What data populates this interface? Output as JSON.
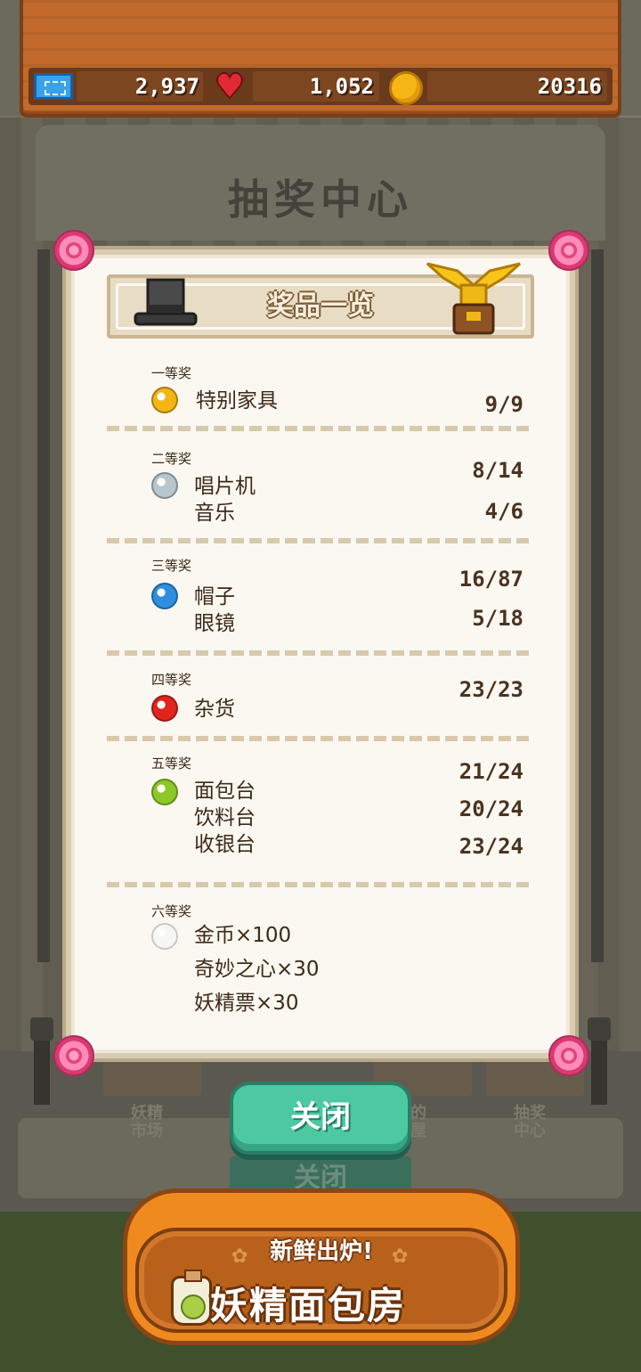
{
  "hud": {
    "tickets": "2,937",
    "hearts": "1,052",
    "coins": "20316"
  },
  "background": {
    "title": "抽奖中心",
    "labels": [
      "妖精\n市场",
      "的\n屋",
      "抽奖\n中心"
    ],
    "close_ghost": "关闭"
  },
  "modal": {
    "title": "奖品一览",
    "tiers": [
      {
        "label": "一等奖",
        "gem_color": "#f2b514",
        "items": [
          {
            "name": "特别家具",
            "count": "9/9"
          }
        ]
      },
      {
        "label": "二等奖",
        "gem_color": "#b7c7cd",
        "items": [
          {
            "name": "唱片机",
            "count": "8/14"
          },
          {
            "name": "音乐",
            "count": "4/6"
          }
        ]
      },
      {
        "label": "三等奖",
        "gem_color": "#2e8fe0",
        "items": [
          {
            "name": "帽子",
            "count": "16/87"
          },
          {
            "name": "眼镜",
            "count": "5/18"
          }
        ]
      },
      {
        "label": "四等奖",
        "gem_color": "#e2241f",
        "items": [
          {
            "name": "杂货",
            "count": "23/23"
          }
        ]
      },
      {
        "label": "五等奖",
        "gem_color": "#8cc928",
        "items": [
          {
            "name": "面包台",
            "count": "21/24"
          },
          {
            "name": "饮料台",
            "count": "20/24"
          },
          {
            "name": "收银台",
            "count": "23/24"
          }
        ]
      },
      {
        "label": "六等奖",
        "gem_color": "#f6f6f4",
        "items": [
          {
            "name": "金币×100"
          },
          {
            "name": "奇妙之心×30"
          },
          {
            "name": "妖精票×30"
          }
        ]
      }
    ]
  },
  "close_button": {
    "label": "关闭"
  },
  "ad": {
    "subtitle": "新鲜出炉!",
    "title": "妖精面包房"
  }
}
